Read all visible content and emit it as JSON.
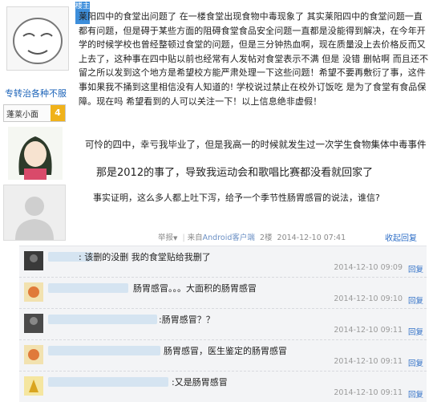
{
  "user": {
    "level_ribbon": "楼主",
    "name": "专转治各种不服",
    "badge_text": "蓬莱小面",
    "badge_num": "4"
  },
  "post": {
    "paragraph1": "莱阳四中的食堂出问题了 在一楼食堂出现食物中毒现象了 其实莱阳四中的食堂问题一直都有问题，但是碍于某些方面的阻碍食堂食品安全问题一直都是没能得到解决，在今年开学的时候学校也曾经整顿过食堂的问题，但是三分钟热血啊，现在质量没上去价格反而又上去了，这种事在四中贴以前也经常有人发帖对食堂表示不满 但是 没错 删帖啊 而且还不留之所以发到这个地方是希望校方能严肃处理一下这些问题！希望不要再敷衍了事，这件事如果我不捅到这里相信没有人知道的! 学校说过禁止在校外订饭吃 是为了食堂有食品保障。现在吗 希望看到的人可以关注一下！以上信息绝非虚假！",
    "line2": "可怜的四中，幸亏我毕业了，但是我高一的时候就发生过一次学生食物集体中毒事件",
    "line3": "那是2012的事了，导致我运动会和歌唱比赛都没看就回家了",
    "line4": "事实证明，这么多人都上吐下泻，给予一个季节性肠胃感冒的说法，谁信?"
  },
  "meta": {
    "report": "举报",
    "arrow": "▼",
    "source_prefix": "来自",
    "source": "Android客户端",
    "floor": "2楼",
    "time": "2014-12-10 07:41",
    "reply_link": "收起回复"
  },
  "replies": [
    {
      "text": ": 该删的没删 我的食堂贴给我删了",
      "time": "2014-12-10 09:09",
      "reply": "回复"
    },
    {
      "text": "肠胃感冒。。。大面积的肠胃感冒",
      "time": "2014-12-10 09:10",
      "reply": "回复"
    },
    {
      "text": ":肠胃感冒？？",
      "time": "2014-12-10 09:11",
      "reply": "回复"
    },
    {
      "text": "肠胃感冒，医生鉴定的肠胃感冒",
      "time": "2014-12-10 09:11",
      "reply": "回复"
    },
    {
      "text": ":又是肠胃感冒",
      "time": "2014-12-10 09:11",
      "reply": "回复"
    }
  ]
}
